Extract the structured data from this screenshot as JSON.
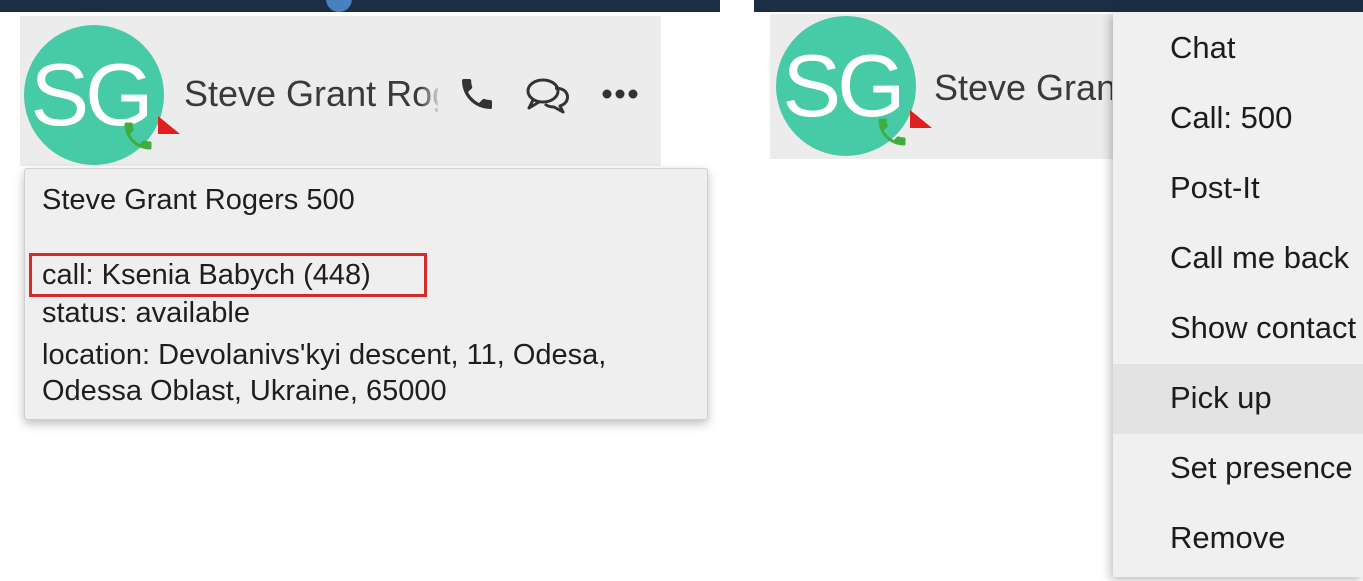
{
  "left_panel": {
    "contact": {
      "initials": "SG",
      "display_name": "Steve Grant Rogers"
    },
    "tooltip": {
      "heading": "Steve Grant Rogers 500",
      "call_line": "call: Ksenia Babych (448)",
      "status_line": "status: available",
      "location_line1": "location: Devolanivs'kyi descent, 11, Odesa,",
      "location_line2": "Odessa Oblast, Ukraine, 65000"
    },
    "icons": [
      "phone-icon",
      "chat-bubbles-icon",
      "more-options-icon"
    ]
  },
  "right_panel": {
    "contact": {
      "initials": "SG",
      "display_name": "Steve Grant Rogers"
    },
    "context_menu": {
      "items": [
        {
          "label": "Chat"
        },
        {
          "label": "Call: 500"
        },
        {
          "label": "Post-It"
        },
        {
          "label": "Call me back"
        },
        {
          "label": "Show contact"
        },
        {
          "label": "Pick up"
        },
        {
          "label": "Set presence"
        },
        {
          "label": "Remove"
        }
      ],
      "hovered_item": "Pick up"
    }
  },
  "colors": {
    "avatar_bg": "#47cba6",
    "presence_phone": "#3fae3f",
    "presence_flag": "#e02020",
    "highlight_border": "#d62a2a",
    "topbar": "#1c2e46"
  }
}
